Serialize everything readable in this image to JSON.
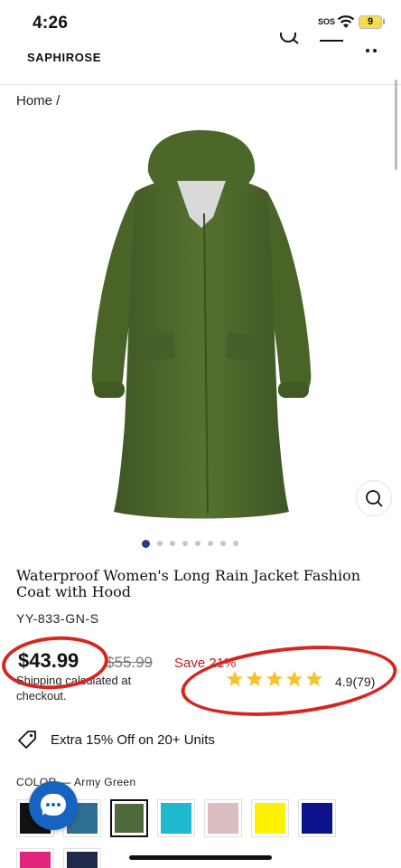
{
  "status_bar": {
    "time": "4:26",
    "sos": "SOS",
    "battery": "9"
  },
  "header": {
    "logo": "SAPHIROSE"
  },
  "breadcrumb": {
    "home": "Home /"
  },
  "gallery": {
    "dot_count": 8,
    "active_index": 0
  },
  "product": {
    "title": "Waterproof Women's Long Rain Jacket Fashion Coat with Hood",
    "sku": "YY-833-GN-S",
    "price": "$43.99",
    "compare_price": "$55.99",
    "save": "Save 21%",
    "shipping": "Shipping calculated at checkout.",
    "rating_stars": 5,
    "rating_text": "4.9(79)"
  },
  "promo": {
    "text": "Extra 15% Off on 20+ Units"
  },
  "color": {
    "label": "COLOR —",
    "selected": "Army Green",
    "swatches": [
      "#111111",
      "#2f6f95",
      "#4e6a3d",
      "#1eb9cf",
      "#dbbfbf",
      "#fff200",
      "#0b128c",
      "#e0257d",
      "#1f2a4a"
    ]
  },
  "colors": {
    "accent": "#d6261e",
    "star": "#f7c22f",
    "sale": "#b2231f",
    "chat": "#1565c0"
  }
}
